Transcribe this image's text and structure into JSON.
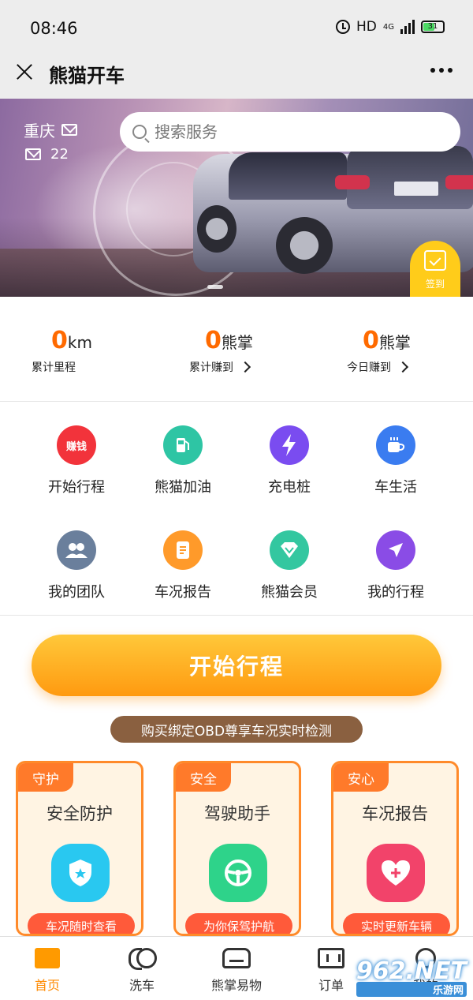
{
  "status_bar": {
    "time": "08:46",
    "network": "HD",
    "signal": "4G",
    "battery": "31"
  },
  "title_bar": {
    "title": "熊猫开车"
  },
  "banner": {
    "city": "重庆",
    "message_count": "22",
    "search_placeholder": "搜索服务",
    "checkin_label": "签到"
  },
  "stats": [
    {
      "value": "0",
      "unit": "km",
      "label": "累计里程"
    },
    {
      "value": "0",
      "unit": "熊掌",
      "label": "累计赚到"
    },
    {
      "value": "0",
      "unit": "熊掌",
      "label": "今日赚到"
    }
  ],
  "services": [
    {
      "label": "开始行程",
      "icon": "earn-money-icon",
      "icon_text": "赚钱",
      "color": "#f2333b"
    },
    {
      "label": "熊猫加油",
      "icon": "fuel-pump-icon",
      "color": "#2ec5a4"
    },
    {
      "label": "充电桩",
      "icon": "lightning-icon",
      "color": "#7a4cf0"
    },
    {
      "label": "车生活",
      "icon": "coffee-cup-icon",
      "color": "#3a7cf0"
    },
    {
      "label": "我的团队",
      "icon": "team-icon",
      "color": "#6a7f9c"
    },
    {
      "label": "车况报告",
      "icon": "report-icon",
      "color": "#ff9a2a"
    },
    {
      "label": "熊猫会员",
      "icon": "diamond-icon",
      "color": "#33c7a0"
    },
    {
      "label": "我的行程",
      "icon": "plane-icon",
      "color": "#8a4ce6"
    }
  ],
  "start_button": {
    "label": "开始行程"
  },
  "obd_banner": {
    "text": "购买绑定OBD尊享车况实时检测"
  },
  "cards": [
    {
      "tag": "守护",
      "title": "安全防护",
      "button": "车况随时查看",
      "icon": "shield-star-icon",
      "icon_color": "#29c8f0"
    },
    {
      "tag": "安全",
      "title": "驾驶助手",
      "button": "为你保驾护航",
      "icon": "steering-wheel-icon",
      "icon_color": "#2ed38a"
    },
    {
      "tag": "安心",
      "title": "车况报告",
      "button": "实时更新车辆",
      "icon": "heart-plus-icon",
      "icon_color": "#f2436a"
    }
  ],
  "bottom_nav": [
    {
      "label": "首页",
      "icon": "home-icon",
      "active": true
    },
    {
      "label": "洗车",
      "icon": "car-wash-icon",
      "active": false
    },
    {
      "label": "熊掌易物",
      "icon": "car-icon",
      "active": false
    },
    {
      "label": "订单",
      "icon": "order-icon",
      "active": false
    },
    {
      "label": "我的",
      "icon": "user-icon",
      "active": false
    }
  ],
  "watermark": {
    "text": "962.NET",
    "subtext": "乐游网"
  },
  "colors": {
    "accent": "#ff8a00",
    "stat_value": "#ff6a00",
    "card_border": "#ff8a2a"
  }
}
